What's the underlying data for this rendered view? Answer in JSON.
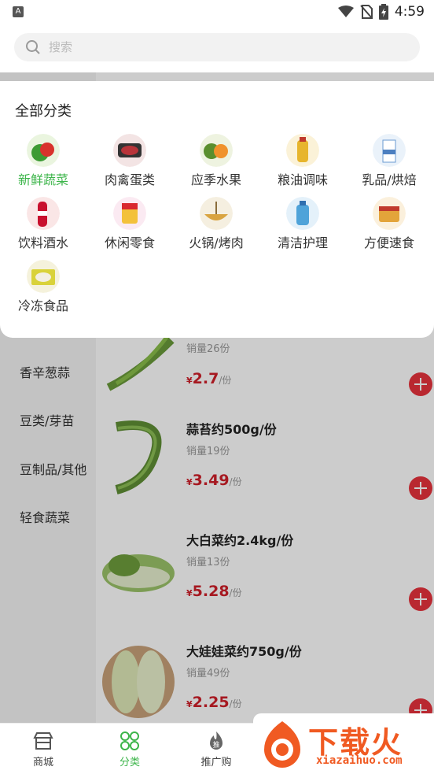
{
  "status_bar": {
    "time": "4:59",
    "notification_badge": "A"
  },
  "search": {
    "placeholder": "搜索"
  },
  "left_nav": {
    "items": [
      {
        "label": "香辛葱蒜"
      },
      {
        "label": "豆类/芽苗"
      },
      {
        "label": "豆制品/其他"
      },
      {
        "label": "轻食蔬菜"
      }
    ]
  },
  "products": [
    {
      "name": "",
      "sales": "销量26份",
      "currency": "¥",
      "price": "2.7",
      "unit": "/份"
    },
    {
      "name": "蒜苔约500g/份",
      "sales": "销量19份",
      "currency": "¥",
      "price": "3.49",
      "unit": "/份"
    },
    {
      "name": "大白菜约2.4kg/份",
      "sales": "销量13份",
      "currency": "¥",
      "price": "5.28",
      "unit": "/份"
    },
    {
      "name": "大娃娃菜约750g/份",
      "sales": "销量49份",
      "currency": "¥",
      "price": "2.25",
      "unit": "/份"
    }
  ],
  "dropdown": {
    "title": "全部分类",
    "categories": [
      {
        "label": "新鲜蔬菜",
        "active": true
      },
      {
        "label": "肉禽蛋类"
      },
      {
        "label": "应季水果"
      },
      {
        "label": "粮油调味"
      },
      {
        "label": "乳品/烘焙"
      },
      {
        "label": "饮料酒水"
      },
      {
        "label": "休闲零食"
      },
      {
        "label": "火锅/烤肉"
      },
      {
        "label": "清洁护理"
      },
      {
        "label": "方便速食"
      },
      {
        "label": "冷冻食品"
      }
    ]
  },
  "tab_bar": {
    "tabs": [
      {
        "label": "商城"
      },
      {
        "label": "分类",
        "active": true
      },
      {
        "label": "推广购"
      }
    ]
  },
  "watermark": {
    "text": "下载火",
    "url": "xiazaihuo.com"
  },
  "colors": {
    "accent_green": "#3cb54a",
    "price_red": "#d0202a",
    "add_button_red": "#e8323c"
  }
}
